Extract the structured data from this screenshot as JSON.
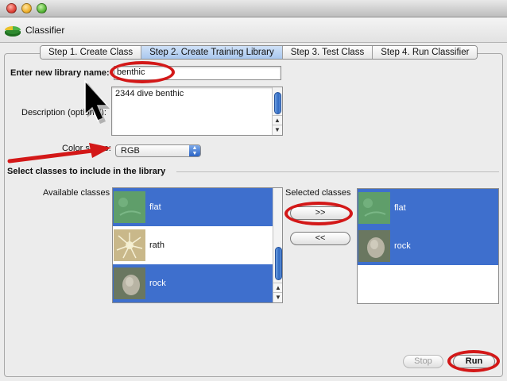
{
  "window": {
    "title": "Classifier"
  },
  "tabs": [
    {
      "label": "Step 1. Create Class",
      "active": false
    },
    {
      "label": "Step 2. Create Training Library",
      "active": true
    },
    {
      "label": "Step 3. Test Class",
      "active": false
    },
    {
      "label": "Step 4. Run Classifier",
      "active": false
    }
  ],
  "form": {
    "library_name_label": "Enter new library name:",
    "library_name_value": "benthic",
    "description_label": "Description (optional):",
    "description_value": "2344 dive benthic",
    "color_space_label": "Color space:",
    "color_space_value": "RGB"
  },
  "section": {
    "title": "Select classes to include in the library",
    "available_label": "Available classes",
    "selected_label": "Selected classes"
  },
  "available_classes": [
    {
      "name": "flat",
      "selected": true
    },
    {
      "name": "rath",
      "selected": false
    },
    {
      "name": "rock",
      "selected": true
    }
  ],
  "selected_classes": [
    {
      "name": "flat",
      "selected": true
    },
    {
      "name": "rock",
      "selected": true
    }
  ],
  "buttons": {
    "add": ">>",
    "remove": "<<",
    "stop": "Stop",
    "run": "Run"
  },
  "colors": {
    "selection": "#3e6fcd",
    "annotation": "#d31818",
    "active_tab": "#a9c7ee"
  },
  "icons": {
    "app": "pie-chart-icon",
    "popup": "up-down-arrows-icon"
  }
}
